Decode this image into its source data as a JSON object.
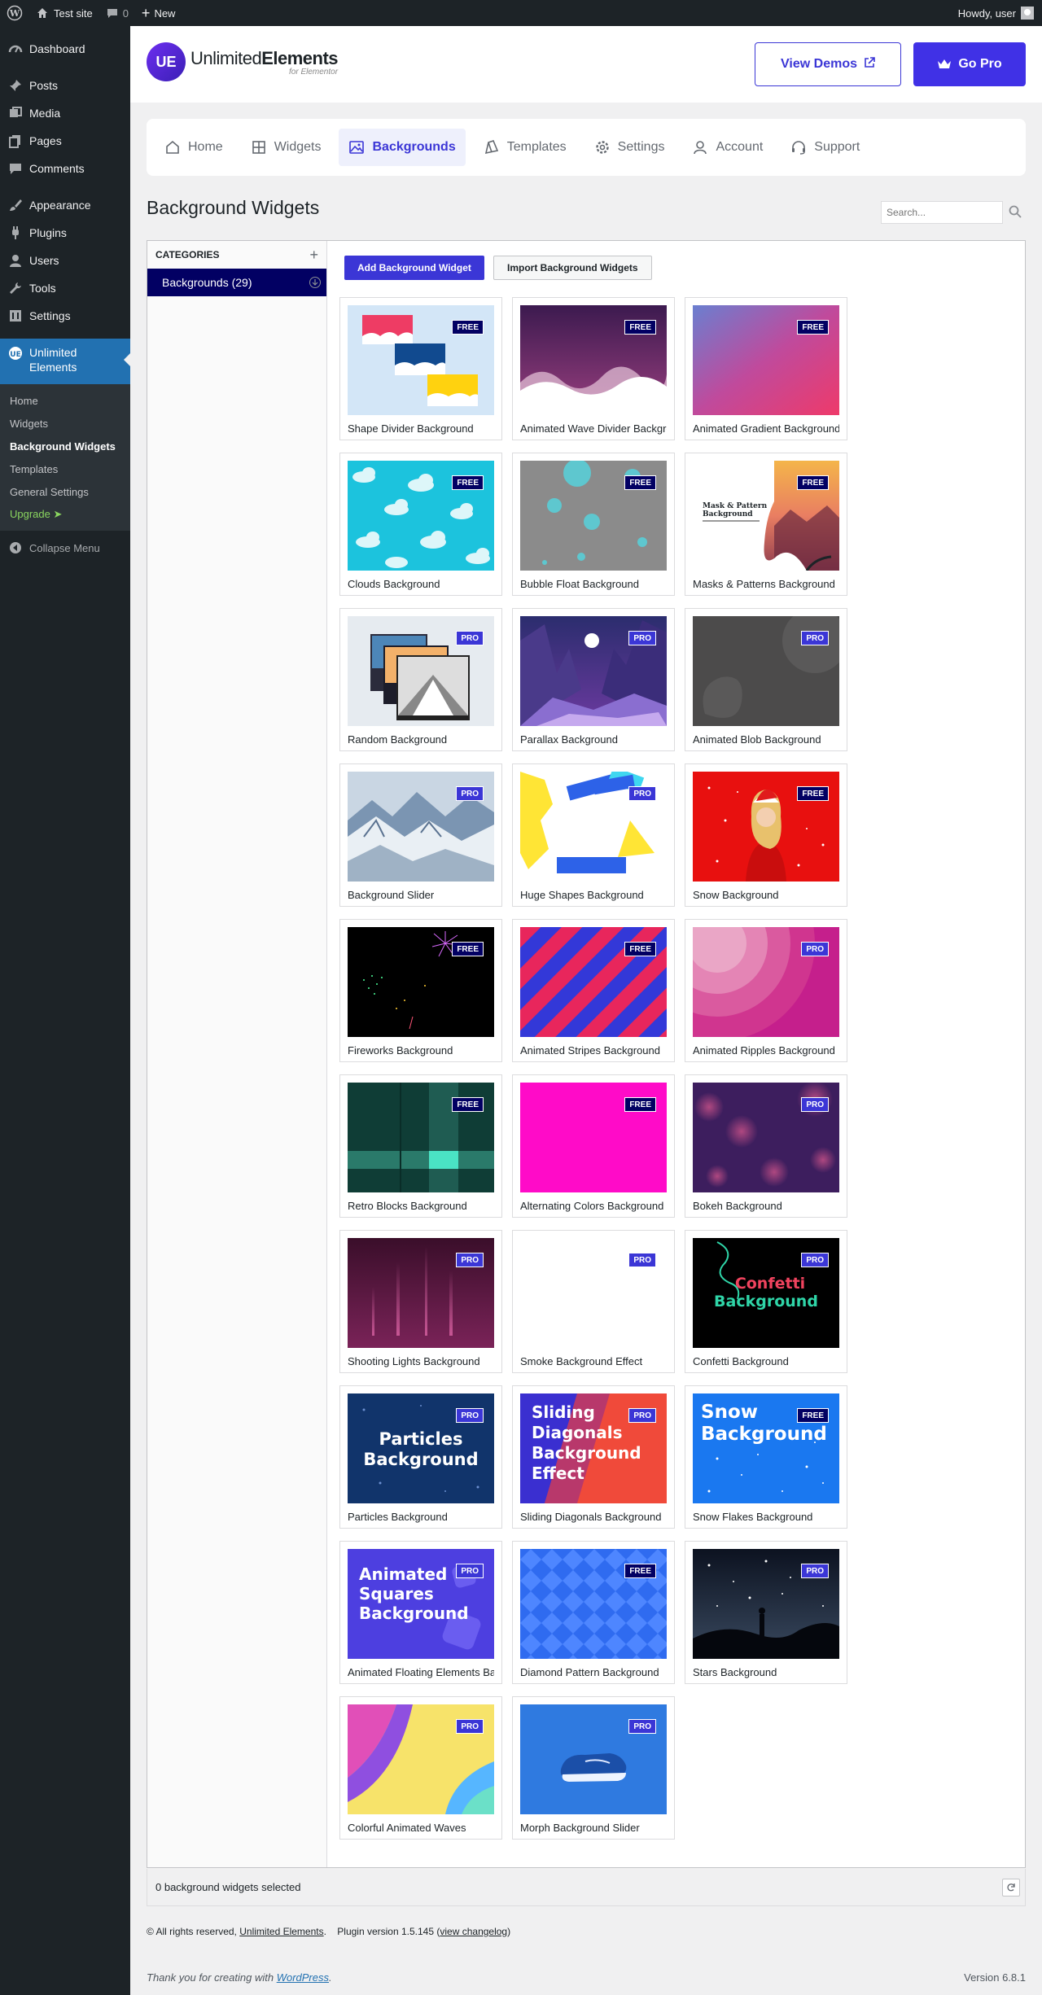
{
  "adminbar": {
    "site_name": "Test site",
    "comments_count": "0",
    "new_label": "New",
    "howdy": "Howdy, user"
  },
  "sidebar": {
    "items": [
      {
        "label": "Dashboard",
        "icon": "dashboard-icon"
      },
      {
        "label": "Posts",
        "icon": "pin-icon"
      },
      {
        "label": "Media",
        "icon": "media-icon"
      },
      {
        "label": "Pages",
        "icon": "pages-icon"
      },
      {
        "label": "Comments",
        "icon": "comment-icon"
      },
      {
        "label": "Appearance",
        "icon": "brush-icon"
      },
      {
        "label": "Plugins",
        "icon": "plug-icon"
      },
      {
        "label": "Users",
        "icon": "user-icon"
      },
      {
        "label": "Tools",
        "icon": "wrench-icon"
      },
      {
        "label": "Settings",
        "icon": "sliders-icon"
      }
    ],
    "active": {
      "label_line1": "Unlimited",
      "label_line2": "Elements"
    },
    "submenu": [
      "Home",
      "Widgets",
      "Background Widgets",
      "Templates",
      "General Settings",
      "Upgrade ➤"
    ],
    "collapse": "Collapse Menu"
  },
  "header": {
    "logo_main_a": "Unlimited",
    "logo_main_b": "Elements",
    "logo_sub": "for Elementor",
    "logo_mark": "UE",
    "view_demos": "View Demos",
    "go_pro": "Go Pro"
  },
  "nav": {
    "tabs": [
      "Home",
      "Widgets",
      "Backgrounds",
      "Templates",
      "Settings",
      "Account",
      "Support"
    ]
  },
  "page": {
    "title": "Background Widgets",
    "search_placeholder": "Search..."
  },
  "categories": {
    "heading": "CATEGORIES",
    "plus": "+",
    "item": "Backgrounds (29)"
  },
  "actions": {
    "add": "Add Background Widget",
    "import": "Import Background Widgets"
  },
  "widgets": [
    {
      "title": "Shape Divider Background",
      "badge": "FREE"
    },
    {
      "title": "Animated Wave Divider Background",
      "badge": "FREE"
    },
    {
      "title": "Animated Gradient Background",
      "badge": "FREE"
    },
    {
      "title": "Clouds Background",
      "badge": "FREE"
    },
    {
      "title": "Bubble Float Background",
      "badge": "FREE"
    },
    {
      "title": "Masks & Patterns Background",
      "badge": "FREE",
      "thumb_text": "Mask & Pattern Background"
    },
    {
      "title": "Random Background",
      "badge": "PRO"
    },
    {
      "title": "Parallax Background",
      "badge": "PRO"
    },
    {
      "title": "Animated Blob Background",
      "badge": "PRO"
    },
    {
      "title": "Background Slider",
      "badge": "PRO"
    },
    {
      "title": "Huge Shapes Background",
      "badge": "PRO"
    },
    {
      "title": "Snow Background",
      "badge": "FREE"
    },
    {
      "title": "Fireworks Background",
      "badge": "FREE"
    },
    {
      "title": "Animated Stripes Background",
      "badge": "FREE"
    },
    {
      "title": "Animated Ripples Background",
      "badge": "PRO"
    },
    {
      "title": "Retro Blocks Background",
      "badge": "FREE"
    },
    {
      "title": "Alternating Colors Background",
      "badge": "FREE"
    },
    {
      "title": "Bokeh Background",
      "badge": "PRO"
    },
    {
      "title": "Shooting Lights Background",
      "badge": "PRO"
    },
    {
      "title": "Smoke Background Effect",
      "badge": "PRO"
    },
    {
      "title": "Confetti Background",
      "badge": "PRO",
      "thumb_text_1": "Confetti",
      "thumb_text_2": "Background"
    },
    {
      "title": "Particles Background",
      "badge": "PRO",
      "thumb_text_1": "Particles",
      "thumb_text_2": "Background"
    },
    {
      "title": "Sliding Diagonals Background",
      "badge": "PRO",
      "thumb_text_1": "Sliding",
      "thumb_text_2": "Diagonals",
      "thumb_text_3": "Background",
      "thumb_text_4": "Effect"
    },
    {
      "title": "Snow Flakes Background",
      "badge": "FREE",
      "thumb_text_1": "Snow",
      "thumb_text_2": "Background"
    },
    {
      "title": "Animated Floating Elements Background",
      "badge": "PRO",
      "thumb_text_1": "Animated",
      "thumb_text_2": "Squares",
      "thumb_text_3": "Background"
    },
    {
      "title": "Diamond Pattern Background",
      "badge": "FREE"
    },
    {
      "title": "Stars Background",
      "badge": "PRO"
    },
    {
      "title": "Colorful Animated Waves",
      "badge": "PRO"
    },
    {
      "title": "Morph Background Slider",
      "badge": "PRO"
    }
  ],
  "status": {
    "selected": "0 background widgets selected"
  },
  "footer": {
    "copyright_prefix": "© All rights reserved,",
    "copyright_link": "Unlimited Elements",
    "plugin_version": "Plugin version 1.5.145",
    "changelog": "view changelog",
    "thanks_prefix": "Thank you for creating with",
    "wordpress": "WordPress",
    "version": "Version 6.8.1"
  },
  "colors": {
    "accent": "#3b36d6",
    "dark_navy": "#020063",
    "admin_dark": "#1d2327",
    "admin_blue": "#2271b1"
  }
}
